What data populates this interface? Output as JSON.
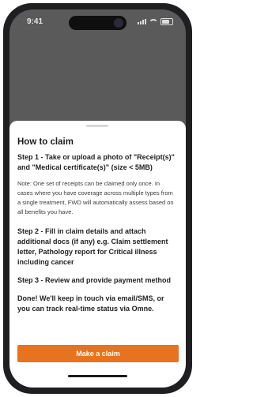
{
  "status_bar": {
    "time": "9:41"
  },
  "claim_sheet": {
    "title": "How to claim",
    "step1": "Step 1 - Take or upload a photo of \"Receipt(s)\" and \"Medical certificate(s)\" (size < 5MB)",
    "note": "Note: One set of receipts can be claimed only once. In cases where you have coverage across multiple types from a single treatment, FWD will automatically assess based on all benefits you have.",
    "step2": "Step 2 - Fill in claim details and attach additional docs (if any) e.g. Claim settlement letter, Pathology report for Critical illness including cancer",
    "step3": "Step 3 - Review and provide payment method",
    "done": "Done! We'll keep in touch via email/SMS, or you can track real-time status via Omne.",
    "button_label": "Make a claim"
  }
}
